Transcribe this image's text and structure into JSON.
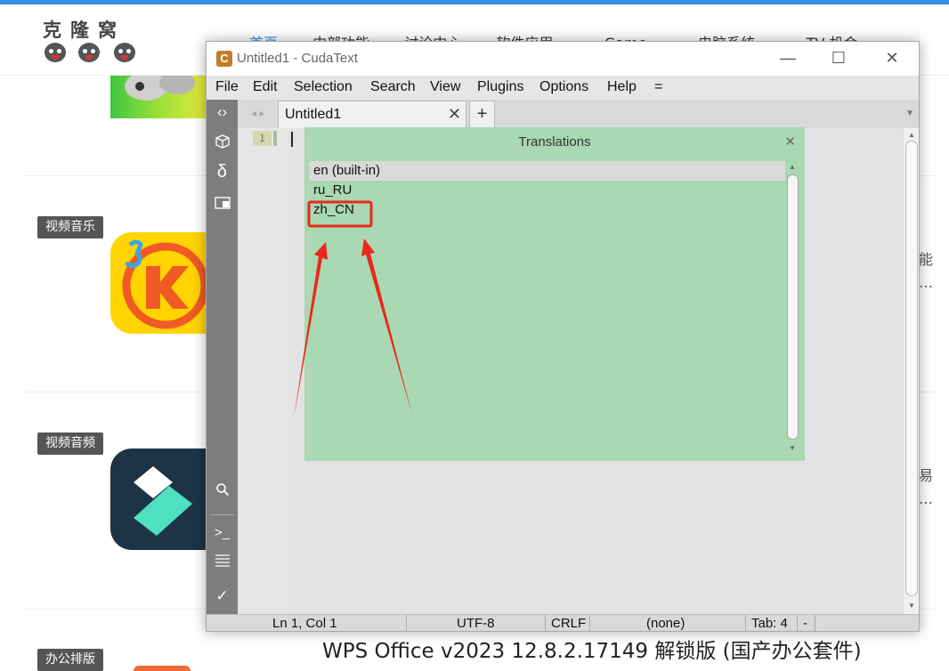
{
  "site": {
    "logo_text": "克隆窝",
    "nav": [
      "首页",
      "内部功能",
      "讨论中心",
      "软件应用 ⌄",
      "Game ⌄",
      "电脑系统 ⌄",
      "TV 机会"
    ],
    "categories": [
      "视频音乐",
      "视频音频",
      "办公排版"
    ],
    "peek_texts": [
      "能",
      "…",
      "易",
      "…"
    ],
    "bottom_title": "WPS Office v2023 12.8.2.17149 解锁版 (国产办公套件)"
  },
  "window": {
    "title": "Untitled1 - CudaText",
    "app_icon_letter": "C",
    "menu": [
      "File",
      "Edit",
      "Selection",
      "Search",
      "View",
      "Plugins",
      "Options",
      "Help",
      "="
    ],
    "tab_label": "Untitled1",
    "line_number": "1",
    "status": {
      "position": "Ln 1, Col 1",
      "encoding": "UTF-8",
      "line_ending": "CRLF",
      "lexer": "(none)",
      "tab": "Tab: 4",
      "extra": "-"
    }
  },
  "dialog": {
    "title": "Translations",
    "items": [
      "en (built-in)",
      "ru_RU",
      "zh_CN"
    ],
    "selected_index": 0,
    "highlighted_item": "zh_CN"
  },
  "colors": {
    "site_accent": "#3a8ee6",
    "dialog_bg": "#a9d8b3",
    "annotation": "#e8291c"
  }
}
